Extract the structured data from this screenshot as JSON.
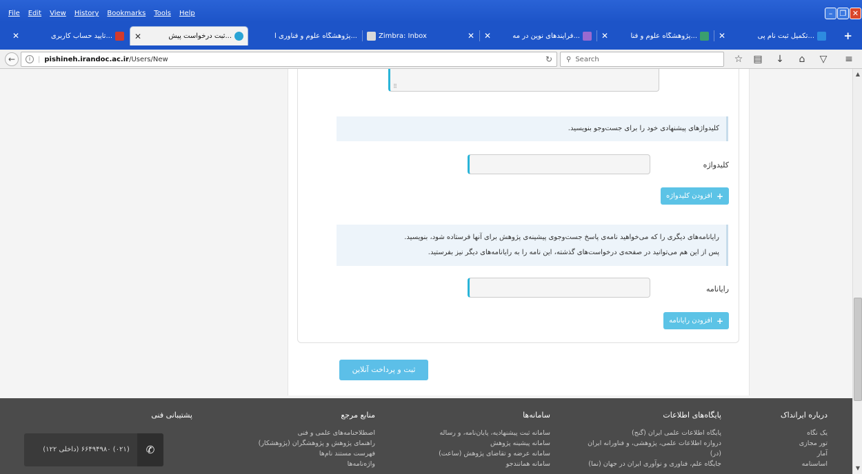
{
  "menu": [
    "File",
    "Edit",
    "View",
    "History",
    "Bookmarks",
    "Tools",
    "Help"
  ],
  "tabs": [
    {
      "label": "...تکمیل ثبت نام پی",
      "active": false
    },
    {
      "label": "...پژوهشگاه علوم و فنا",
      "active": false
    },
    {
      "label": "...فرآیندهای نوین در مه",
      "active": false
    },
    {
      "label": "Zimbra: Inbox",
      "active": false
    },
    {
      "label": "...پژوهشگاه علوم و فناوری ا",
      "active": false
    },
    {
      "label": "...ثبت درخواست پیش",
      "active": true
    },
    {
      "label": "...تأیید حساب کاربری",
      "active": false
    }
  ],
  "url": {
    "domain": "pishineh.irandoc.ac.ir",
    "path": "/Users/New",
    "prefix": ""
  },
  "search_placeholder": "Search",
  "form": {
    "keyword_note": "کلیدواژهای پیشنهادی خود را برای جست‌وجو بنویسید.",
    "keyword_label": "کلیدواژه",
    "add_keyword": "افزودن کلیدواژه",
    "email_note_1": "رایانامه‌های دیگری را که می‌خواهید نامه‌ی پاسخ جست‌وجوی پیشینه‌ی پژوهش برای آنها فرستاده شود، بنویسید.",
    "email_note_2": "پس از این هم می‌توانید در صفحه‌ی درخواست‌های گذشته، این نامه را به رایانامه‌های دیگر نیز بفرستید.",
    "email_label": "رایانامه",
    "add_email": "افزودن رایانامه",
    "submit": "ثبت و پرداخت آنلاین"
  },
  "footer": {
    "about": {
      "title": "درباره ایرانداک",
      "items": [
        "یک نگاه",
        "تور مجازی",
        "آمار",
        "اساسنامه"
      ]
    },
    "databases": {
      "title": "پایگاه‌های اطلاعات",
      "items": [
        "پایگاه اطلاعات علمی ایران (گنج)",
        "دروازه اطلاعات علمی، پژوهشی، و فناورانه ایران",
        "(در)",
        "جایگاه علم، فناوری و نوآوری ایران در جهان (نما)"
      ]
    },
    "systems": {
      "title": "سامانه‌ها",
      "items": [
        "سامانه ثبت پیشنهادیه، پایان‌نامه، و رساله",
        "سامانه پیشینه پژوهش",
        "سامانه عرضه و تقاضای پژوهش (ساعت)",
        "سامانه همانندجو"
      ]
    },
    "references": {
      "title": "منابع مرجع",
      "items": [
        "اصطلاحنامه‌های علمی و فنی",
        "راهنمای پژوهش و پژوهشگران (پژوهشکار)",
        "فهرست مستند نام‌ها",
        "واژه‌نامه‌ها"
      ]
    },
    "support": {
      "title": "پشتیبانی فنی",
      "phone": "(۰۲۱) ۶۶۴۹۴۹۸۰ (داخلی ۱۲۲)"
    }
  }
}
